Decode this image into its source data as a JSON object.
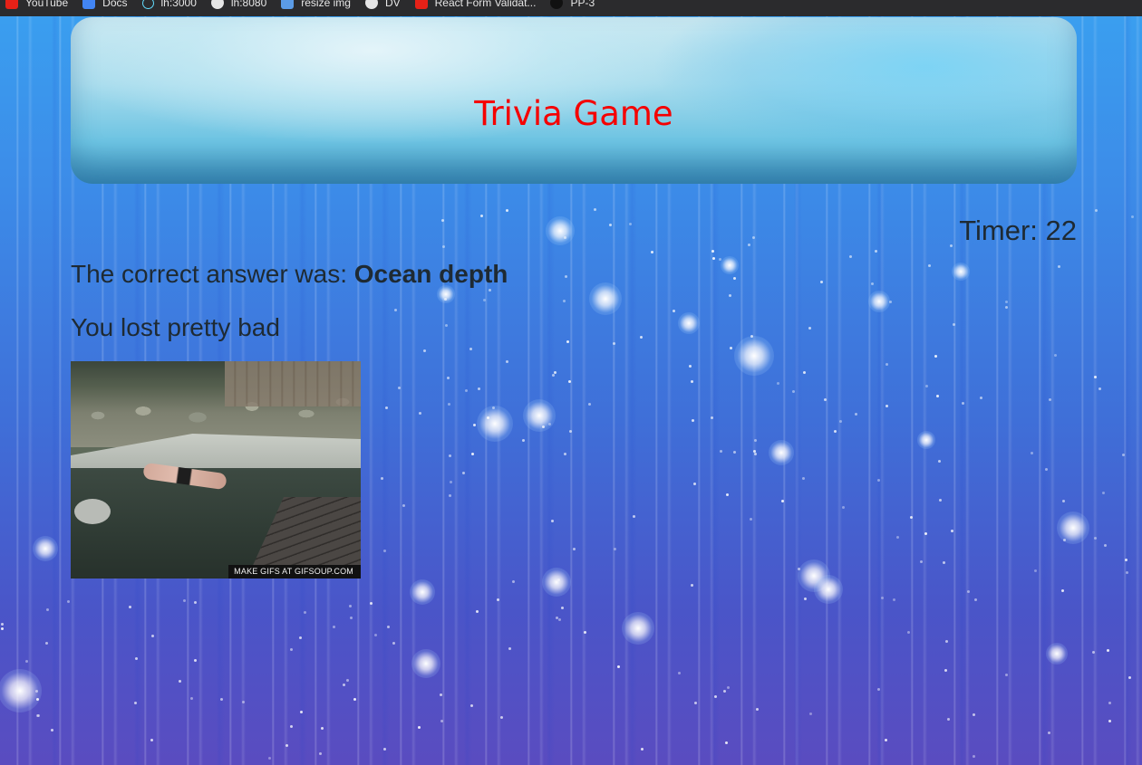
{
  "bookmarks": [
    {
      "label": "YouTube",
      "icon": "youtube-icon"
    },
    {
      "label": "Docs",
      "icon": "docs-icon"
    },
    {
      "label": "lh:3000",
      "icon": "react-icon"
    },
    {
      "label": "lh:8080",
      "icon": "globe-icon"
    },
    {
      "label": "resize img",
      "icon": "resize-icon"
    },
    {
      "label": "DV",
      "icon": "globe-icon"
    },
    {
      "label": "React Form Validat...",
      "icon": "youtube-icon"
    },
    {
      "label": "PP-3",
      "icon": "github-icon"
    }
  ],
  "header": {
    "title": "Trivia Game",
    "title_color": "#f50000"
  },
  "timer": {
    "label": "Timer:",
    "value": "22"
  },
  "result": {
    "answer_prefix": "The correct answer was:",
    "answer_value": "Ocean depth",
    "message": "You lost pretty bad"
  },
  "gif": {
    "caption": "MAKE GIFS AT GIFSOUP.COM"
  }
}
